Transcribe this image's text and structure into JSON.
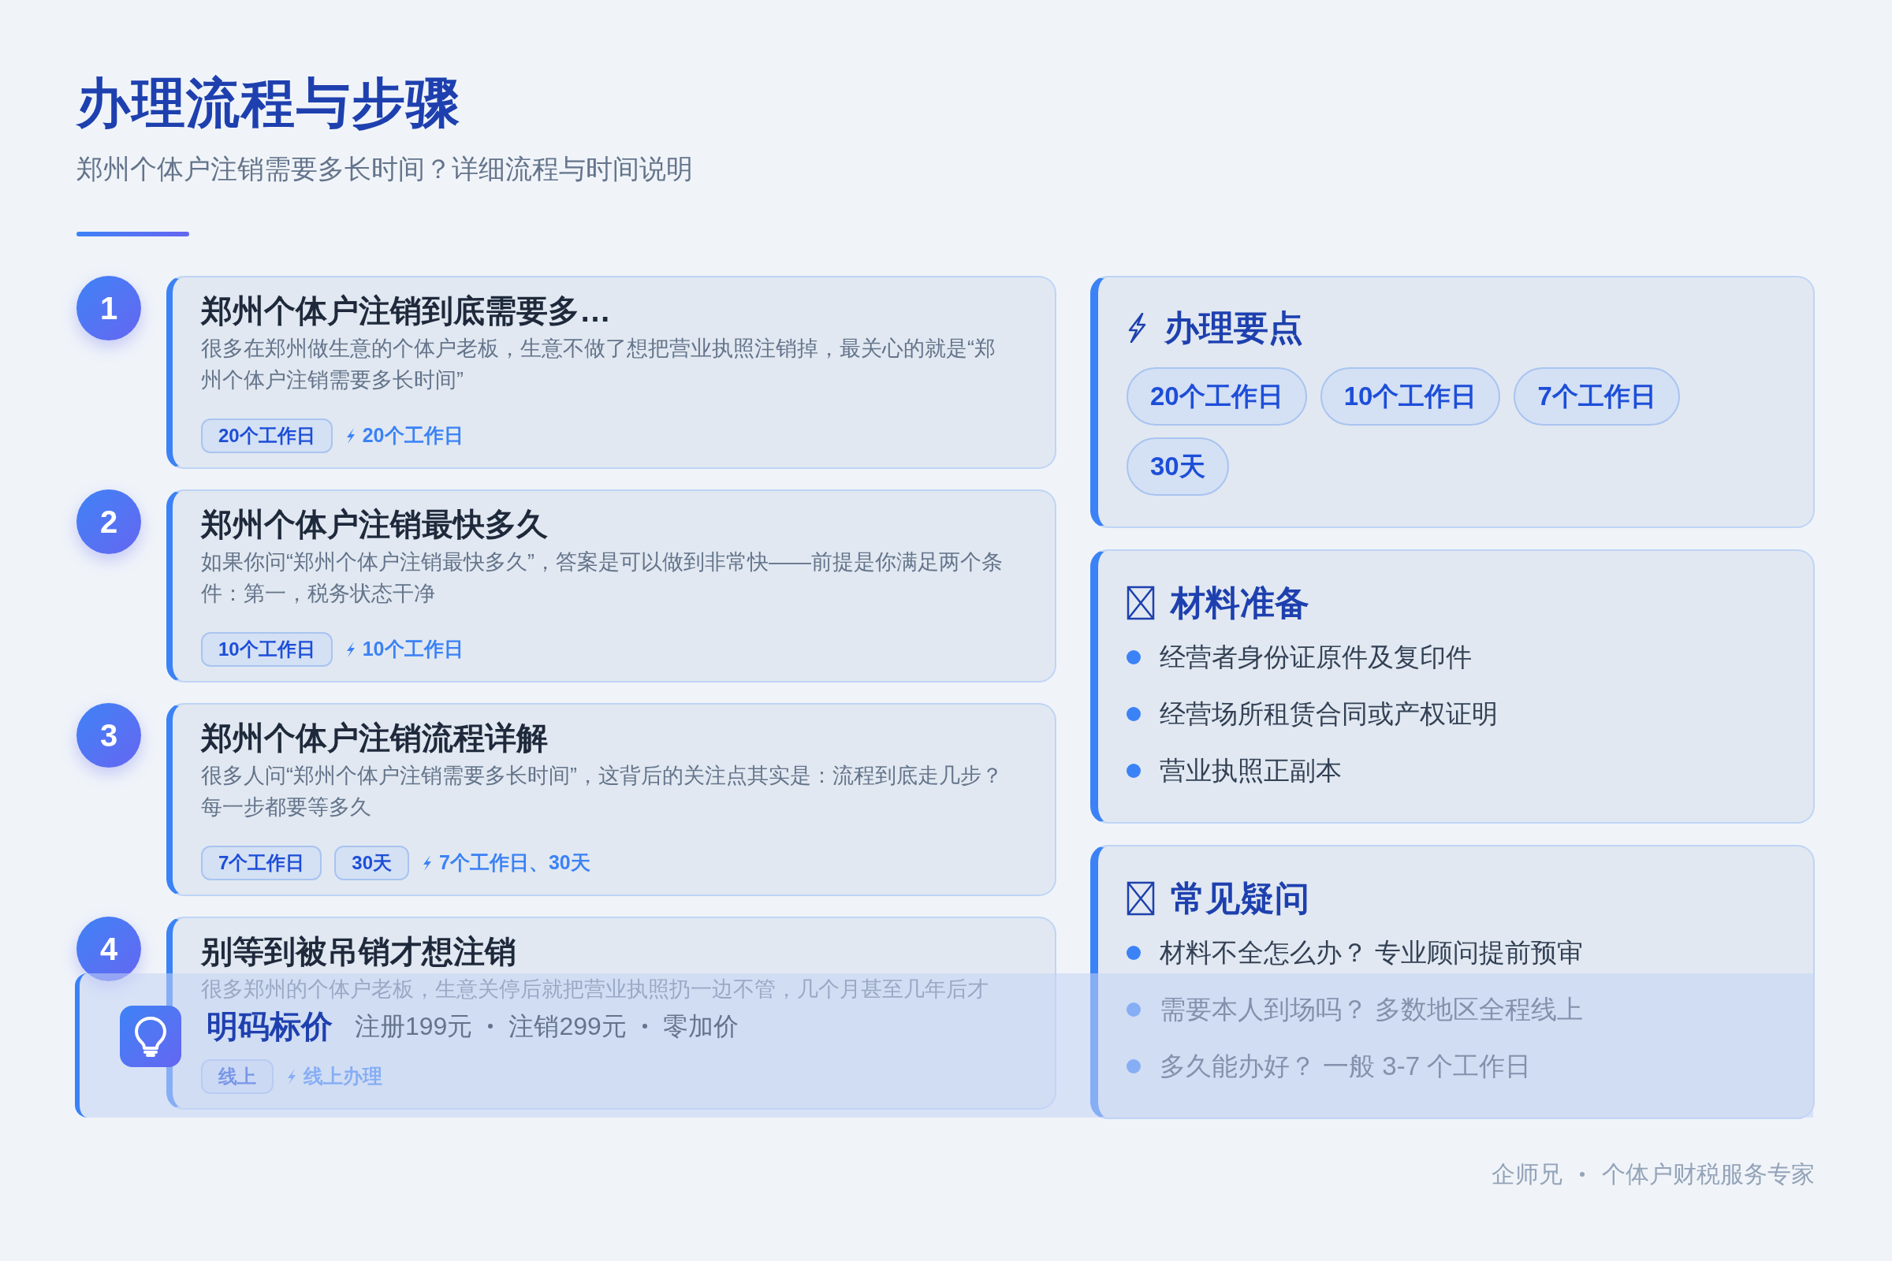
{
  "header": {
    "title": "办理流程与步骤",
    "subtitle": "郑州个体户注销需要多长时间？详细流程与时间说明"
  },
  "steps": [
    {
      "number": "1",
      "title": "郑州个体户注销到底需要多…",
      "description": "很多在郑州做生意的个体户老板，生意不做了想把营业执照注销掉，最关心的就是“郑州个体户注销需要多长时间”",
      "tags": [
        "20个工作日"
      ],
      "highlight": "20个工作日"
    },
    {
      "number": "2",
      "title": "郑州个体户注销最快多久",
      "description": "如果你问“郑州个体户注销最快多久”，答案是可以做到非常快——前提是你满足两个条件：第一，税务状态干净",
      "tags": [
        "10个工作日"
      ],
      "highlight": "10个工作日"
    },
    {
      "number": "3",
      "title": "郑州个体户注销流程详解",
      "description": "很多人问“郑州个体户注销需要多长时间”，这背后的关注点其实是：流程到底走几步？每一步都要等多久",
      "tags": [
        "7个工作日",
        "30天"
      ],
      "highlight": "7个工作日、30天"
    },
    {
      "number": "4",
      "title": "别等到被吊销才想注销",
      "description": "很多郑州的个体户老板，生意关停后就把营业执照扔一边不管，几个月甚至几年后才",
      "tags": [
        "线上"
      ],
      "highlight": "线上办理"
    }
  ],
  "key_points": {
    "title": "办理要点",
    "tags": [
      "20个工作日",
      "10个工作日",
      "7个工作日",
      "30天"
    ]
  },
  "materials": {
    "title": "材料准备",
    "items": [
      "经营者身份证原件及复印件",
      "经营场所租赁合同或产权证明",
      "营业执照正副本"
    ]
  },
  "faq": {
    "title": "常见疑问",
    "items": [
      "材料不全怎么办？ 专业顾问提前预审",
      "需要本人到场吗？ 多数地区全程线上",
      "多久能办好？ 一般 3-7 个工作日"
    ]
  },
  "banner": {
    "title": "明码标价",
    "prices": [
      "注册199元",
      "注销299元",
      "零加价"
    ]
  },
  "footer": {
    "brand": "企师兄",
    "tagline": "个体户财税服务专家"
  }
}
